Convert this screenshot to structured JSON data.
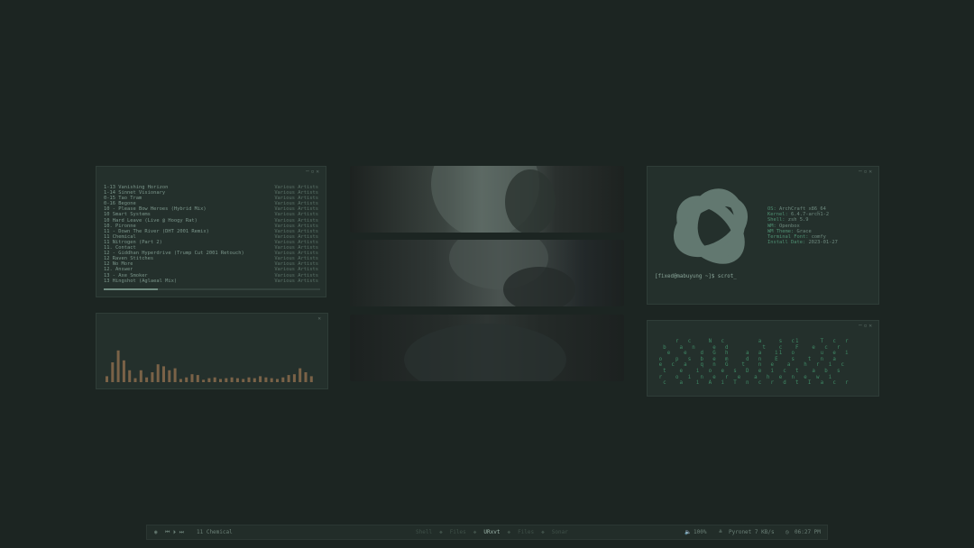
{
  "player": {
    "tracks": [
      {
        "title": "1-13 Vanishing Horizon",
        "artist": "Various Artists"
      },
      {
        "title": "1-14 Sinnet Visionary",
        "artist": "Various Artists"
      },
      {
        "title": "0-15 Tao Tram",
        "artist": "Various Artists"
      },
      {
        "title": "0-16 Begone",
        "artist": "Various Artists"
      },
      {
        "title": "10 - Please Bow Heroes (Hybrid Mix)",
        "artist": "Various Artists"
      },
      {
        "title": "10 Smart Systems",
        "artist": "Various Artists"
      },
      {
        "title": "10 Hard Leave (Live @ Hoogy Rat)",
        "artist": "Various Artists"
      },
      {
        "title": "10. Pironne",
        "artist": "Various Artists"
      },
      {
        "title": "11 - Down The River (DHT 2001 Remix)",
        "artist": "Various Artists"
      },
      {
        "title": "11 Chemical",
        "artist": "Various Artists"
      },
      {
        "title": "11 Nitrogen (Part 2)",
        "artist": "Various Artists"
      },
      {
        "title": "11. Contact",
        "artist": "Various Artists"
      },
      {
        "title": "12 - Giddhan Hyperdrive (Trump Cut 2001 Retouch)",
        "artist": "Various Artists"
      },
      {
        "title": "12 Raven Stitches",
        "artist": "Various Artists"
      },
      {
        "title": "12 No More",
        "artist": "Various Artists"
      },
      {
        "title": "12. Answer",
        "artist": "Various Artists"
      },
      {
        "title": "13 - Axe Smoker",
        "artist": "Various Artists"
      },
      {
        "title": "13 Hingshot (Aglaeal Mix)",
        "artist": "Various Artists"
      }
    ],
    "progress": 0.25
  },
  "visualizer": {
    "levels": [
      0.15,
      0.5,
      0.8,
      0.55,
      0.3,
      0.1,
      0.3,
      0.12,
      0.25,
      0.45,
      0.4,
      0.3,
      0.35,
      0.08,
      0.12,
      0.2,
      0.18,
      0.06,
      0.1,
      0.12,
      0.08,
      0.1,
      0.12,
      0.1,
      0.08,
      0.12,
      0.1,
      0.15,
      0.12,
      0.1,
      0.08,
      0.12,
      0.18,
      0.2,
      0.35,
      0.25,
      0.15
    ],
    "bar_color": "#8a6b4c"
  },
  "fetch": {
    "info": [
      {
        "key": "OS:",
        "value": "ArchCraft x86_64"
      },
      {
        "key": "Kernel:",
        "value": "6.4.7-arch1-2"
      },
      {
        "key": "Shell:",
        "value": "zsh 5.9"
      },
      {
        "key": "WM:",
        "value": "Openbox"
      },
      {
        "key": "WM Theme:",
        "value": "Grace"
      },
      {
        "key": "Terminal Font:",
        "value": "comfy"
      },
      {
        "key": "Install Date:",
        "value": "2023-01-27"
      }
    ],
    "prompt": "[fixed@mabuyung ~]$ scrot_"
  },
  "matrix": {
    "lines": [
      "     r  c    N  c        a    s  c1     T  c  r",
      "  b   a  n    e  d        t   c   F   e  c  r",
      "   e   e   d  G  h    a  a   i1  o      u  e  i",
      " o   p  s  b  e  m    d  n   E   s   t  n  a",
      " e  c  a   q  n  G   t   n  e   a   h  r  i  c",
      "  t   e   i  o  e  s  D  e  i  c  t   a  b  s",
      " r   o  i  n  e  r  e   a  h  e  n  e  w  i",
      "  c   a   i  A  i  T  n  c  r  d  t  I  a  c  r"
    ]
  },
  "statusbar": {
    "player_controls": "⏮ ⏵ ⏭",
    "now_playing": "11 Chemical",
    "workspaces": [
      {
        "label": "Shell",
        "active": false
      },
      {
        "label": "Files",
        "active": false
      },
      {
        "label": "URxvt",
        "active": true
      },
      {
        "label": "Files",
        "active": false
      },
      {
        "label": "Sonar",
        "active": false
      }
    ],
    "volume": "100%",
    "network": "Pyronet 7 KB/s",
    "clock": "06:27 PM"
  }
}
